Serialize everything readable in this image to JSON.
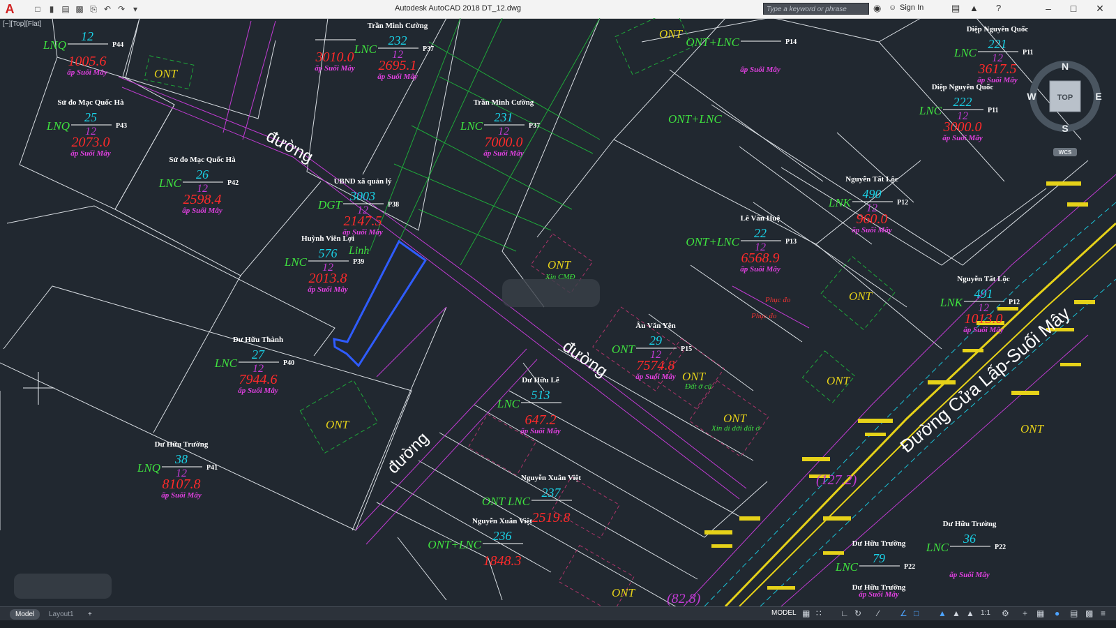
{
  "app": {
    "title": "Autodesk AutoCAD 2018    DT_12.dwg",
    "search_placeholder": "Type a keyword or phrase",
    "signin_label": "Sign In",
    "logo": "A",
    "viewport_label": "[−][Top][Flat]"
  },
  "viewcube": {
    "n": "N",
    "s": "S",
    "e": "E",
    "w": "W",
    "top": "TOP",
    "wcs": "WCS"
  },
  "status": {
    "tab_model": "Model",
    "tab_layout": "Layout1",
    "tab_add": "+",
    "model_button": "MODEL",
    "scale": "1:1"
  },
  "drawing": {
    "roads": {
      "road1": "đường",
      "road2": "đường",
      "road3": "đường",
      "main": "Đường Cửa Lấp-Suối Mây"
    },
    "zones": {
      "ont1": "ONT",
      "ont2": "ONT",
      "ont3": "ONT",
      "ont4": "ONT",
      "ont5": "ONT",
      "ont6": "ONT",
      "ont7": "ONT",
      "ont8": "ONT",
      "ont9": "ONT",
      "ontlnc1": "ONT+LNC",
      "linh": "Linh",
      "xin_cmd": "Xin CMĐ",
      "xin_di_doi": "Xin di dời đất ở",
      "dat_o_cu": "Đất ở cũ",
      "phuc_do1": "Phục đo",
      "phuc_do2": "Phục đo",
      "dim1": "(127.2)",
      "dim2": "(82.8)"
    },
    "parcels": [
      {
        "owner": "",
        "type": "LNQ",
        "num": "12",
        "area": "1005.6",
        "sheet": "P44",
        "loc": "ấp Suối Mây"
      },
      {
        "owner": "Trần Minh Cường",
        "type": "LNC",
        "num": "232",
        "sheet_num": "12",
        "area": "2695.1",
        "sheet": "P37",
        "loc": "ấp Suối Mây"
      },
      {
        "owner": "Trần Minh Cường",
        "type": "LNC",
        "num": "231",
        "sheet_num": "12",
        "area": "7000.0",
        "sheet": "P37",
        "loc": "ấp Suối Mây"
      },
      {
        "owner": "Sử đo Mạc Quốc Hà",
        "type": "LNQ",
        "num": "25",
        "sheet_num": "12",
        "area": "2073.0",
        "sheet": "P43",
        "loc": "ấp Suối Mây"
      },
      {
        "owner": "Sử đo Mạc Quốc Hà",
        "type": "LNC",
        "num": "26",
        "sheet_num": "12",
        "area": "2598.4",
        "sheet": "P42",
        "loc": "ấp Suối Mây"
      },
      {
        "owner": "UBND xã quản lý",
        "type": "DGT",
        "num": "3003",
        "sheet_num": "12",
        "area": "2147.5",
        "sheet": "P38",
        "loc": "ấp Suối Mây"
      },
      {
        "owner": "Huỳnh Viên Lợi",
        "type": "LNC",
        "num": "576",
        "sheet_num": "12",
        "area": "2013.8",
        "sheet": "P39",
        "loc": "ấp Suối Mây"
      },
      {
        "owner": "Dư Hữu Thành",
        "type": "LNC",
        "num": "27",
        "sheet_num": "12",
        "area": "7944.6",
        "sheet": "P40",
        "loc": "ấp Suối Mây"
      },
      {
        "owner": "Dư Hữu Trường",
        "type": "LNQ",
        "num": "38",
        "sheet_num": "12",
        "area": "8107.8",
        "sheet": "P41",
        "loc": "ấp Suối Mây"
      },
      {
        "owner": "Âu Văn Yên",
        "type": "ONT",
        "num": "29",
        "sheet_num": "12",
        "area": "7574.8",
        "sheet": "P15",
        "loc": "ấp Suối Mây"
      },
      {
        "owner": "Lê Văn Huệ",
        "type": "ONT+LNC",
        "num": "22",
        "sheet_num": "12",
        "area": "6568.9",
        "sheet": "P13",
        "loc": "ấp Suối Mây"
      },
      {
        "owner": "Diệp Nguyên Quốc",
        "type": "LNC",
        "num": "221",
        "sheet_num": "12",
        "area": "3617.5",
        "sheet": "P11",
        "loc": "ấp Suối Mây"
      },
      {
        "owner": "Diệp Nguyên Quốc",
        "type": "LNC",
        "num": "222",
        "sheet_num": "12",
        "area": "3000.0",
        "sheet": "P11",
        "loc": "ấp Suối Mây"
      },
      {
        "owner": "Nguyễn Tất Lộc",
        "type": "LNK",
        "num": "490",
        "sheet_num": "12",
        "area": "960.0",
        "sheet": "P12",
        "loc": "ấp Suối Mây"
      },
      {
        "owner": "Nguyễn Tất Lộc",
        "type": "LNK",
        "num": "491",
        "sheet_num": "12",
        "area": "1013.0",
        "sheet": "P12",
        "loc": "ấp Suối Mây"
      },
      {
        "owner": "Dư Hữu Trường",
        "type": "LNC",
        "num": "36",
        "sheet_num": "",
        "area": "",
        "sheet": "P22",
        "loc": "ấp Suối Mây"
      },
      {
        "owner": "Dư Hữu Trường",
        "type": "LNC",
        "num": "79",
        "sheet_num": "",
        "area": "",
        "sheet": "P22",
        "loc": "ấp Suối Mây"
      },
      {
        "owner": "Dư Hữu Trường",
        "type": "LNC",
        "num": "",
        "sheet_num": "",
        "area": "",
        "sheet": "P22",
        "loc": ""
      },
      {
        "owner": "Nguyễn Xuân Việt",
        "type": "ONT LNC",
        "num": "237",
        "sheet_num": "",
        "area": "2519.8",
        "sheet": "",
        "loc": ""
      },
      {
        "owner": "Nguyễn Xuân Việt",
        "type": "ONT+LNC",
        "num": "236",
        "sheet_num": "",
        "area": "1848.3",
        "sheet": "",
        "loc": ""
      },
      {
        "owner": "Dư Hữu Lễ",
        "type": "LNC",
        "num": "513",
        "sheet_num": "",
        "area": "647.2",
        "sheet": "",
        "loc": "ấp Suối Mây"
      },
      {
        "owner": "",
        "type": "ONT+LNC",
        "num": "",
        "sheet_num": "",
        "area": "",
        "sheet": "P14",
        "loc": "ấp Suối Mây"
      },
      {
        "owner": "",
        "type": "",
        "num": "",
        "sheet_num": "",
        "area": "3010.0",
        "sheet": "",
        "loc": "ấp Suối Mây"
      }
    ]
  }
}
